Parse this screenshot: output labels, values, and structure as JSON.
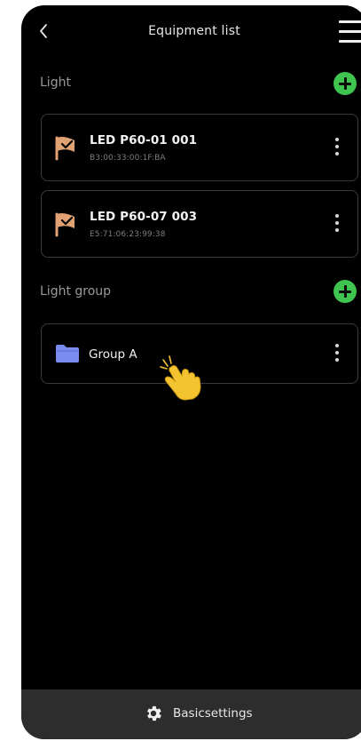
{
  "header": {
    "title": "Equipment list",
    "back_icon": "chevron-left-icon",
    "menu_icon": "hamburger-menu-icon"
  },
  "lights_section": {
    "label": "Light",
    "add_icon": "plus-circle-icon",
    "devices": [
      {
        "name": "LED P60-01 001",
        "mac": "B3:00:33:00:1F:BA",
        "icon": "light-panel-icon"
      },
      {
        "name": "LED P60-07 003",
        "mac": "E5:71:06:23:99:38",
        "icon": "light-panel-icon"
      }
    ]
  },
  "groups_section": {
    "label": "Light group",
    "add_icon": "plus-circle-icon",
    "groups": [
      {
        "name": "Group A",
        "icon": "folder-icon"
      }
    ]
  },
  "footer": {
    "settings_label": "Basicsettings",
    "settings_icon": "gear-icon"
  },
  "colors": {
    "background": "#000000",
    "accent_green": "#3fc450",
    "device_icon_orange": "#e0a273",
    "folder_blue": "#7b8cf0",
    "card_border": "#3a3a3a",
    "bottom_bar": "#2d2d2d",
    "hand_yellow": "#f4c430"
  }
}
